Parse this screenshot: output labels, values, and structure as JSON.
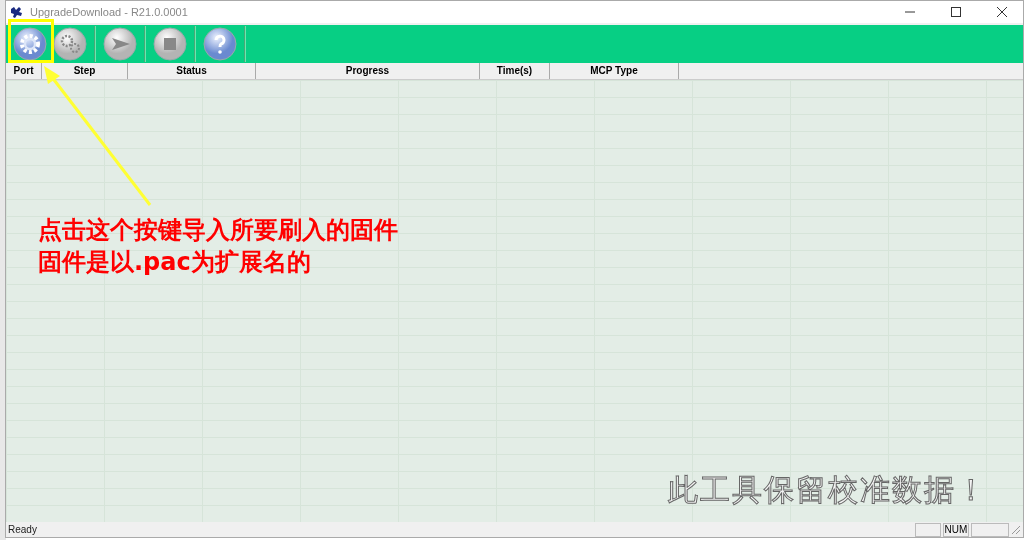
{
  "window": {
    "title": "UpgradeDownload - R21.0.0001"
  },
  "toolbar": [
    {
      "kind": "load"
    },
    {
      "kind": "settings"
    },
    {
      "kind": "start",
      "separator_before": true
    },
    {
      "kind": "stop",
      "separator_before": true
    },
    {
      "kind": "help",
      "separator_before": true
    }
  ],
  "table": {
    "columns": [
      "Port",
      "Step",
      "Status",
      "Progress",
      "Time(s)",
      "MCP Type"
    ]
  },
  "status_bar": {
    "text": "Ready",
    "indicators": [
      {
        "kind": "blank"
      },
      {
        "kind": "text",
        "text": "NUM"
      },
      {
        "kind": "blank"
      }
    ]
  },
  "annotations": [
    {
      "kind": "callout",
      "lines": [
        "点击这个按键导入所要刷入的固件",
        "固件是以.pac为扩展名的"
      ]
    },
    {
      "kind": "outline",
      "text": "此工具保留校准数据！"
    }
  ]
}
